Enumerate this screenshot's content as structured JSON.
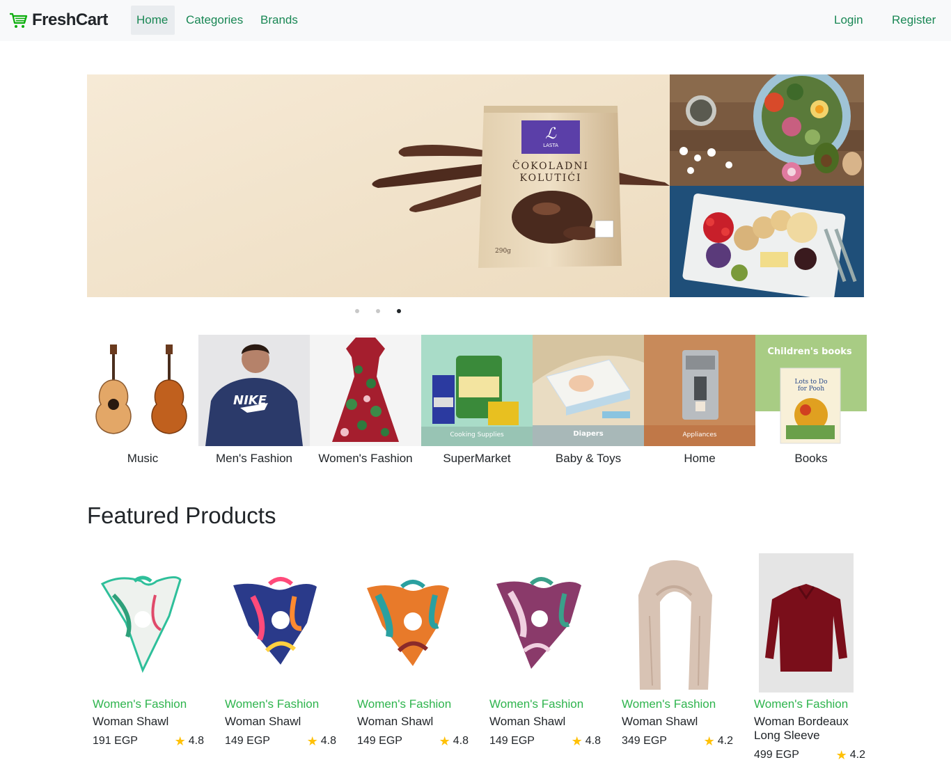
{
  "navbar": {
    "brand": "FreshCart",
    "links": [
      "Home",
      "Categories",
      "Brands"
    ],
    "auth": [
      "Login",
      "Register"
    ]
  },
  "slider": {
    "main_image": "chocolate-cookies-package-image",
    "main_text": [
      "LASTA",
      "ČOKOLADNI",
      "KOLUTIĆI",
      "290g"
    ],
    "side_images": [
      "healthy-food-bowl-image",
      "cheese-platter-image"
    ],
    "dots": 3,
    "active_dot": 2
  },
  "categories": [
    {
      "label": "Music",
      "image": "guitars-image"
    },
    {
      "label": "Men's Fashion",
      "image": "nike-hoodie-man-image"
    },
    {
      "label": "Women's Fashion",
      "image": "floral-dress-image"
    },
    {
      "label": "SuperMarket",
      "image": "cooking-supplies-image",
      "caption": "Cooking Supplies"
    },
    {
      "label": "Baby & Toys",
      "image": "diapers-image",
      "caption": "Diapers"
    },
    {
      "label": "Home",
      "image": "coffee-machine-image",
      "caption": "Appliances"
    },
    {
      "label": "Books",
      "image": "childrens-book-image",
      "caption": "Children's books"
    }
  ],
  "featured": {
    "title": "Featured Products",
    "products": [
      {
        "category": "Women's Fashion",
        "name": "Woman Shawl",
        "price": "191 EGP",
        "rating": "4.8",
        "image": "white-green-shawl-image"
      },
      {
        "category": "Women's Fashion",
        "name": "Woman Shawl",
        "price": "149 EGP",
        "rating": "4.8",
        "image": "pink-blue-shawl-image"
      },
      {
        "category": "Women's Fashion",
        "name": "Woman Shawl",
        "price": "149 EGP",
        "rating": "4.8",
        "image": "orange-teal-shawl-image"
      },
      {
        "category": "Women's Fashion",
        "name": "Woman Shawl",
        "price": "149 EGP",
        "rating": "4.8",
        "image": "purple-floral-shawl-image"
      },
      {
        "category": "Women's Fashion",
        "name": "Woman Shawl",
        "price": "349 EGP",
        "rating": "4.2",
        "image": "beige-scarf-image"
      },
      {
        "category": "Women's Fashion",
        "name": "Woman Bordeaux Long Sleeve",
        "price": "499 EGP",
        "rating": "4.2",
        "image": "bordeaux-shirt-image"
      }
    ]
  },
  "colors": {
    "accent": "#198754",
    "category_green": "#2eb44d",
    "star": "#ffc107",
    "navbar_bg": "#f8f9fa"
  }
}
